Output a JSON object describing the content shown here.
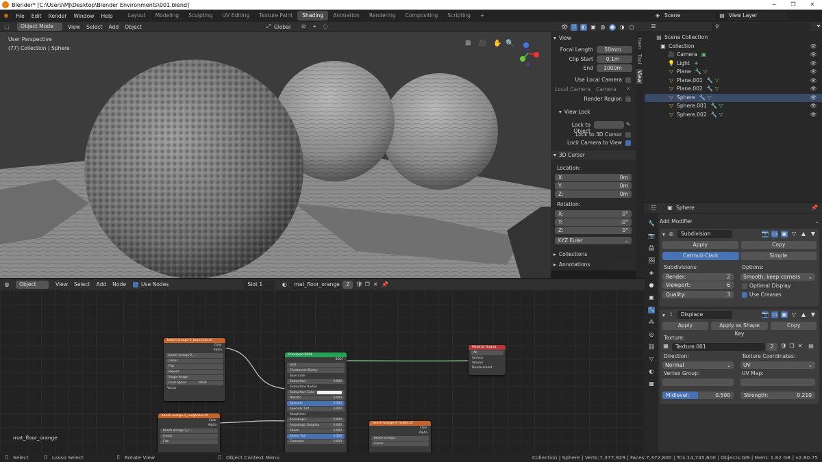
{
  "window": {
    "title": "Blender* [C:\\Users\\MJ\\Desktop\\Blender Environments\\001.blend]",
    "min": "─",
    "max": "❐",
    "close": "✕"
  },
  "menu": [
    "File",
    "Edit",
    "Render",
    "Window",
    "Help"
  ],
  "workspaces": [
    "Layout",
    "Modeling",
    "Sculpting",
    "UV Editing",
    "Texture Paint",
    "Shading",
    "Animation",
    "Rendering",
    "Compositing",
    "Scripting"
  ],
  "add_ws": "+",
  "scene": {
    "label": "Scene",
    "view_layer": "View Layer"
  },
  "view3d": {
    "mode": "Object Mode",
    "menus": [
      "View",
      "Select",
      "Add",
      "Object"
    ],
    "orientation": "Global",
    "overlay_title": "User Perspective",
    "overlay_sub": "(77) Collection | Sphere"
  },
  "npanel": {
    "view_title": "View",
    "focal_label": "Focal Length",
    "focal": "50mm",
    "clip_start_label": "Clip Start",
    "clip_start": "0.1m",
    "end_label": "End",
    "end": "1000m",
    "use_local_cam": "Use Local Camera",
    "local_cam_label": "Local Camera",
    "local_cam": "Camera",
    "render_region": "Render Region",
    "view_lock": "View Lock",
    "lock_obj": "Lock to Object",
    "lock_3d": "Lock to 3D Cursor",
    "lock_cam": "Lock Camera to View",
    "cursor_title": "3D Cursor",
    "location": "Location:",
    "x": "X:",
    "y": "Y:",
    "z": "Z:",
    "lx": "0m",
    "ly": "0m",
    "lz": "0m",
    "rotation": "Rotation:",
    "rx": "0°",
    "ry": "-0°",
    "rz": "0°",
    "euler": "XYZ Euler",
    "collections": "Collections",
    "annotations": "Annotations"
  },
  "ntabs": [
    "Item",
    "Tool",
    "View"
  ],
  "outliner": {
    "root": "Scene Collection",
    "items": [
      "Collection",
      "Camera",
      "Light",
      "Plane",
      "Plane.001",
      "Plane.002",
      "Sphere",
      "Sphere.001",
      "Sphere.002"
    ]
  },
  "props": {
    "object": "Sphere",
    "add_modifier": "Add Modifier",
    "subdiv": {
      "name": "Subdivision",
      "apply": "Apply",
      "copy": "Copy",
      "catmull": "Catmull-Clark",
      "simple": "Simple",
      "subdivisions": "Subdivisions:",
      "render_l": "Render:",
      "render": "2",
      "viewport_l": "Viewport:",
      "viewport": "6",
      "quality_l": "Quality:",
      "quality": "3",
      "options": "Options:",
      "smooth": "Smooth, keep corners",
      "optimal": "Optimal Display",
      "creases": "Use Creases"
    },
    "disp": {
      "name": "Displace",
      "apply": "Apply",
      "shape": "Apply as Shape Key",
      "copy": "Copy",
      "texture_l": "Texture:",
      "texture": "Texture.001",
      "users": "2",
      "direction_l": "Direction:",
      "direction": "Normal",
      "texcoord_l": "Texture Coordinates:",
      "texcoord": "UV",
      "vgroup_l": "Vertex Group:",
      "uvmap_l": "UV Map:",
      "midlevel_l": "Midlevel:",
      "midlevel": "0.500",
      "strength_l": "Strength:",
      "strength": "0.210"
    }
  },
  "node_editor": {
    "type": "Object",
    "menus": [
      "View",
      "Select",
      "Add",
      "Node"
    ],
    "use_nodes": "Use Nodes",
    "slot": "Slot 1",
    "material": "mat_floor_orange",
    "users": "2",
    "corner_label": "mat_floor_orange"
  },
  "nodes": {
    "tex1": {
      "title": "beach-orange-2_baseColor.tif",
      "out1": "Color",
      "out2": "Alpha",
      "img": "beach-orange-2_...",
      "r1": "Linear",
      "r2": "Flat",
      "r3": "Repeat",
      "r4": "Single Image",
      "cs_l": "Color Space",
      "cs": "sRGB",
      "vec": "Vector"
    },
    "tex2": {
      "title": "beach-orange-2_roughness.tif",
      "out1": "Color",
      "out2": "Alpha",
      "img": "beach-orange-2_r...",
      "r1": "Linear",
      "r2": "Flat"
    },
    "tex3": {
      "title": "beach-orange-2_height.tif",
      "out1": "Color",
      "out2": "Alpha",
      "img": "beach-orange...",
      "r1": "Linear"
    },
    "bsdf": {
      "title": "Principled BSDF",
      "out": "BSDF",
      "rows": [
        "GGX",
        "Christensen-Burley",
        "Base Color",
        "Subsurface",
        "Subsurface Radius",
        "Subsurface Color",
        "Metallic",
        "Specular",
        "Specular Tint",
        "Roughness",
        "Anisotropic",
        "Anisotropic Rotation",
        "Sheen",
        "Sheen Tint",
        "Clearcoat"
      ],
      "vals": [
        "",
        "",
        "",
        "0.000",
        "",
        "",
        "0.000",
        "0.500",
        "0.000",
        "",
        "0.000",
        "0.000",
        "0.000",
        "0.500",
        "0.000"
      ]
    },
    "out": {
      "title": "Material Output",
      "target": "All",
      "rows": [
        "Surface",
        "Volume",
        "Displacement"
      ]
    }
  },
  "status": {
    "select": "Select",
    "lasso": "Lasso Select",
    "rotate": "Rotate View",
    "context": "Object Context Menu",
    "info": "Collection | Sphere | Verts:7,377,929 | Faces:7,372,800 | Tris:14,745,600 | Objects:0/8 | Mem: 1.82 GB | v2.80.75"
  },
  "colors": {
    "accent": "#4772b3",
    "tex_header": "#c4632c",
    "bsdf_header": "#27a05a",
    "output_header": "#b13a3a",
    "orange": "#e87d0d"
  }
}
